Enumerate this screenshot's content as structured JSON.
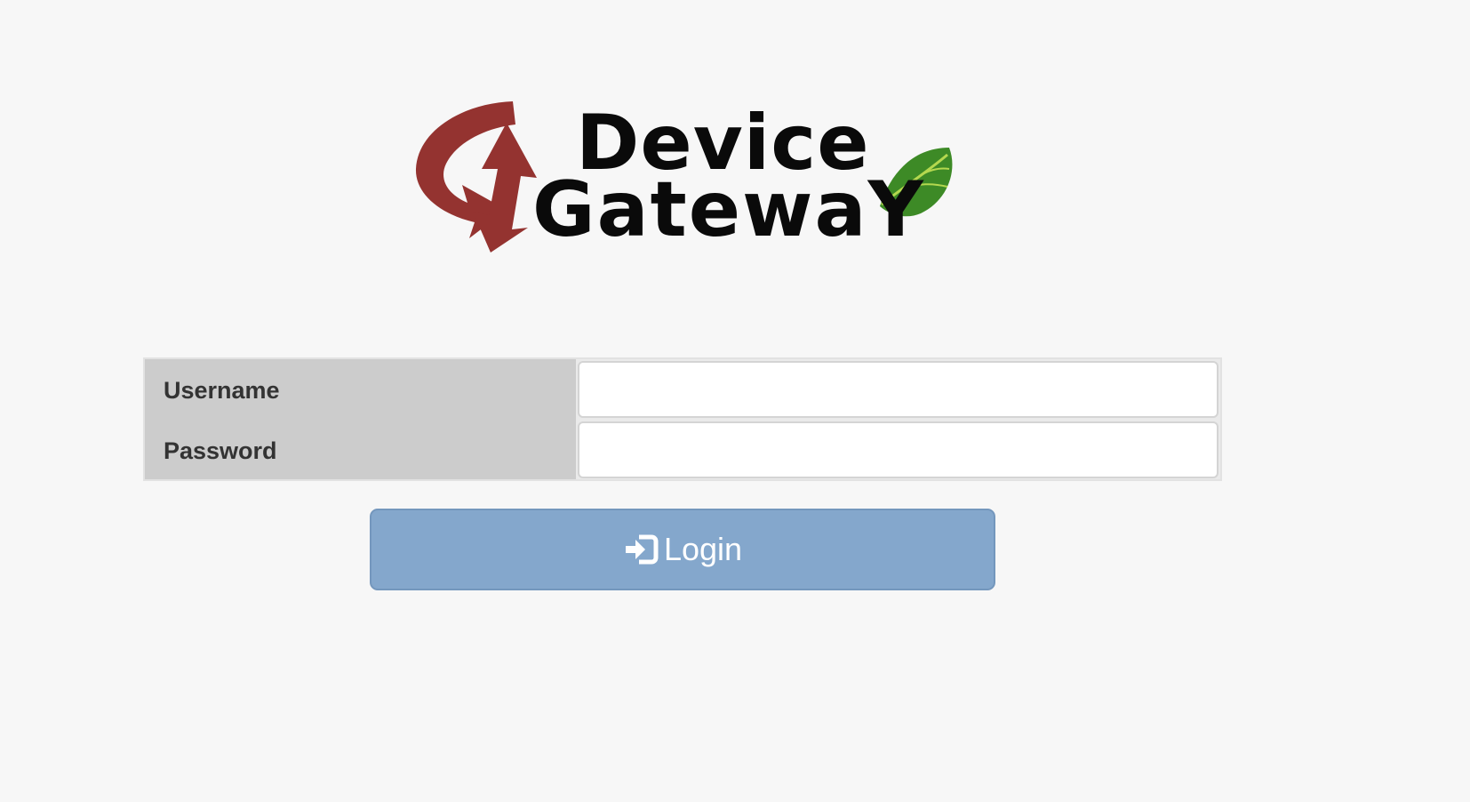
{
  "logo": {
    "line1": "Device",
    "line2": "GatewaY",
    "colors": {
      "arrow": "#943330",
      "text": "#0a0a0a",
      "leaf": "#3d8a26",
      "leaf_vein": "#b4d84f"
    }
  },
  "form": {
    "username_label": "Username",
    "password_label": "Password",
    "username_value": "",
    "password_value": "",
    "username_placeholder": "",
    "password_placeholder": ""
  },
  "login_button": {
    "label": "Login",
    "icon": "sign-in-icon",
    "color": "#84a7cc"
  },
  "colors": {
    "page_background": "#f7f7f7",
    "label_background": "#cccccc",
    "label_text": "#333333"
  }
}
